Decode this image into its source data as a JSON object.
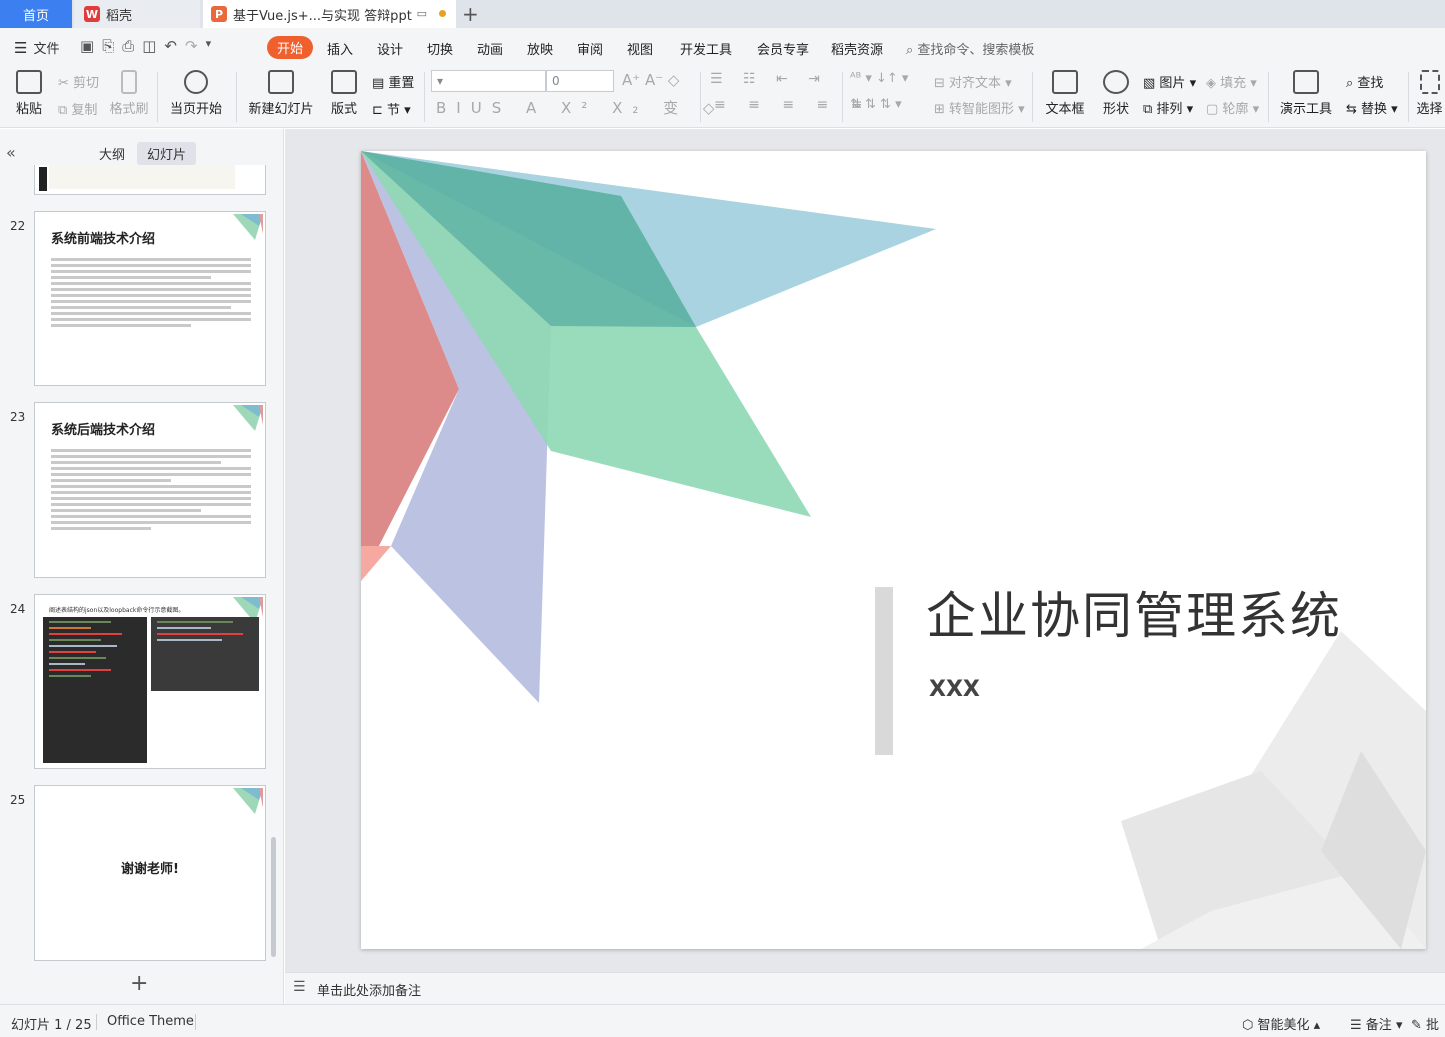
{
  "tabs": {
    "home": "首页",
    "daoke": "稻壳",
    "doc": "基于Vue.js+...与实现 答辩ppt"
  },
  "menu": {
    "file": "文件",
    "items": [
      "开始",
      "插入",
      "设计",
      "切换",
      "动画",
      "放映",
      "审阅",
      "视图",
      "开发工具",
      "会员专享",
      "稻壳资源"
    ],
    "search": "查找命令、搜索模板"
  },
  "ribbon": {
    "paste": "粘贴",
    "cut": "剪切",
    "copy": "复制",
    "format_painter": "格式刷",
    "from_current": "当页开始",
    "new_slide": "新建幻灯片",
    "layout": "版式",
    "reset": "重置",
    "section": "节",
    "font_size": "0",
    "align_text": "对齐文本",
    "smart_shape": "转智能图形",
    "textbox": "文本框",
    "shape": "形状",
    "picture": "图片",
    "arrange": "排列",
    "fill": "填充",
    "outline": "轮廓",
    "present_tools": "演示工具",
    "find": "查找",
    "replace": "替换",
    "select": "选择"
  },
  "left_panel": {
    "outline_tab": "大纲",
    "slides_tab": "幻灯片",
    "thumbs": [
      {
        "num": "22",
        "title": "系统前端技术介绍"
      },
      {
        "num": "23",
        "title": "系统后端技术介绍"
      },
      {
        "num": "24",
        "title": "阐述表结构的json以及loopback命令行示意截图。"
      },
      {
        "num": "25",
        "title": "谢谢老师!"
      }
    ]
  },
  "slide": {
    "title": "企业协同管理系统",
    "subtitle": "XXX"
  },
  "notes_placeholder": "单击此处添加备注",
  "status": {
    "slide_count": "幻灯片 1 / 25",
    "theme": "Office Theme",
    "beautify": "智能美化",
    "notes": "备注",
    "comment": "批"
  },
  "colors": {
    "accent": "#f0602e",
    "home_tab": "#3c7ff0",
    "slide_teal": "#7fbcd0",
    "slide_green": "#6fcf9f",
    "slide_red": "#d46a6a",
    "slide_lavender": "#a8b0dc"
  }
}
